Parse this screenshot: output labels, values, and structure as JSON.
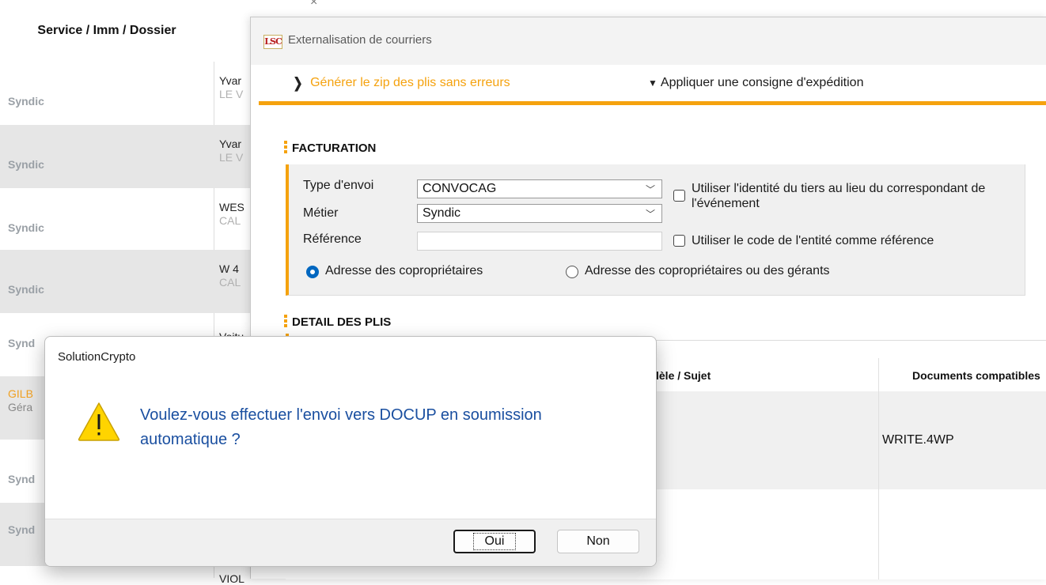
{
  "background": {
    "header": "Service / Imm / Dossier",
    "rows": [
      {
        "service": "Syndic",
        "name": "Yvar",
        "sub": "LE V",
        "shade": false
      },
      {
        "service": "Syndic",
        "name": "Yvar",
        "sub": "LE V",
        "shade": true
      },
      {
        "service": "Syndic",
        "name": "WES",
        "sub": "CAL",
        "shade": false
      },
      {
        "service": "Syndic",
        "name": "W 4",
        "sub": "CAL",
        "shade": true
      },
      {
        "service": "Synd",
        "name": "Voitu",
        "sub": "",
        "shade": false
      },
      {
        "service": "Synd",
        "name": "GILB",
        "sub": "Géra",
        "shade": true
      },
      {
        "service": "Synd",
        "name": "",
        "sub": "",
        "shade": false
      },
      {
        "service": "Synd",
        "name": "VIOL",
        "sub": "",
        "shade": true
      }
    ]
  },
  "window": {
    "logo": "LSC",
    "title": "Externalisation de courriers",
    "toolbar": {
      "zip_label": "Générer le zip des plis sans erreurs",
      "consigne_label": "Appliquer une consigne d'expédition"
    },
    "facturation": {
      "heading": "FACTURATION",
      "type_envoi_label": "Type d'envoi",
      "type_envoi_value": "CONVOCAG",
      "metier_label": "Métier",
      "metier_value": "Syndic",
      "reference_label": "Référence",
      "reference_value": "",
      "cb_identite_label": "Utiliser l'identité du tiers au lieu du correspondant de l'événement",
      "cb_identite_checked": false,
      "cb_code_label": "Utiliser le code de l'entité comme référence",
      "cb_code_checked": false,
      "radio_copro_label": "Adresse des copropriétaires",
      "radio_gerants_label": "Adresse des copropriétaires ou des gérants",
      "selected_address": "copro"
    },
    "plis": {
      "heading": "DETAIL DES PLIS",
      "col_modele": "lèle / Sujet",
      "col_documents": "Documents compatibles",
      "rows": [
        {
          "documents": "WRITE.4WP"
        }
      ]
    }
  },
  "dialog": {
    "title": "SolutionCrypto",
    "message": "Voulez-vous effectuer l'envoi vers DOCUP en soumission automatique ?",
    "yes_label": "Oui",
    "no_label": "Non"
  },
  "colors": {
    "accent": "#f5a20e",
    "message_text": "#1a4fa0",
    "radio_selected": "#0067c0"
  }
}
